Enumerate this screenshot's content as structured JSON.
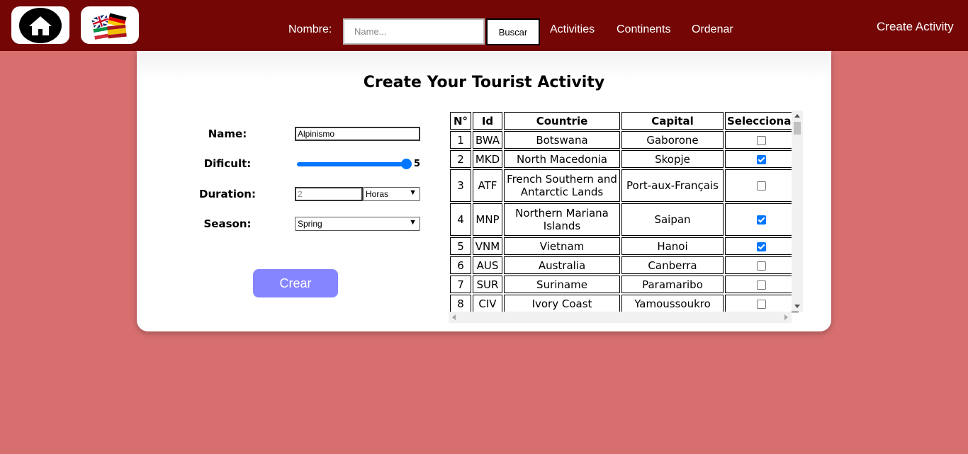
{
  "nav": {
    "search_label": "Nombre:",
    "search_placeholder": "Name...",
    "search_button": "Buscar",
    "links": [
      "Activities",
      "Continents",
      "Ordenar"
    ],
    "create_link": "Create Activity"
  },
  "form": {
    "title": "Create Your Tourist Activity",
    "name_label": "Name:",
    "name_value": "Alpinismo",
    "difficulty_label": "Dificult:",
    "difficulty_value": "5",
    "difficulty_max": 5,
    "duration_label": "Duration:",
    "duration_value": "2",
    "duration_unit": "Horas",
    "season_label": "Season:",
    "season_value": "Spring",
    "submit_label": "Crear"
  },
  "table": {
    "headers": [
      "N°",
      "Id",
      "Countrie",
      "Capital",
      "Seleccionar"
    ],
    "rows": [
      {
        "n": "1",
        "id": "BWA",
        "country": "Botswana",
        "capital": "Gaborone",
        "selected": false
      },
      {
        "n": "2",
        "id": "MKD",
        "country": "North Macedonia",
        "capital": "Skopje",
        "selected": true
      },
      {
        "n": "3",
        "id": "ATF",
        "country": "French Southern and Antarctic Lands",
        "capital": "Port-aux-Français",
        "selected": false
      },
      {
        "n": "4",
        "id": "MNP",
        "country": "Northern Mariana Islands",
        "capital": "Saipan",
        "selected": true
      },
      {
        "n": "5",
        "id": "VNM",
        "country": "Vietnam",
        "capital": "Hanoi",
        "selected": true
      },
      {
        "n": "6",
        "id": "AUS",
        "country": "Australia",
        "capital": "Canberra",
        "selected": false
      },
      {
        "n": "7",
        "id": "SUR",
        "country": "Suriname",
        "capital": "Paramaribo",
        "selected": false
      },
      {
        "n": "8",
        "id": "CIV",
        "country": "Ivory Coast",
        "capital": "Yamoussoukro",
        "selected": false
      }
    ]
  },
  "colors": {
    "navbar": "#740606",
    "background": "#d76f6f",
    "accent": "#0075ff",
    "button": "#8585ff"
  },
  "icons": {
    "home": "home-icon",
    "flags": "flags-icon"
  }
}
